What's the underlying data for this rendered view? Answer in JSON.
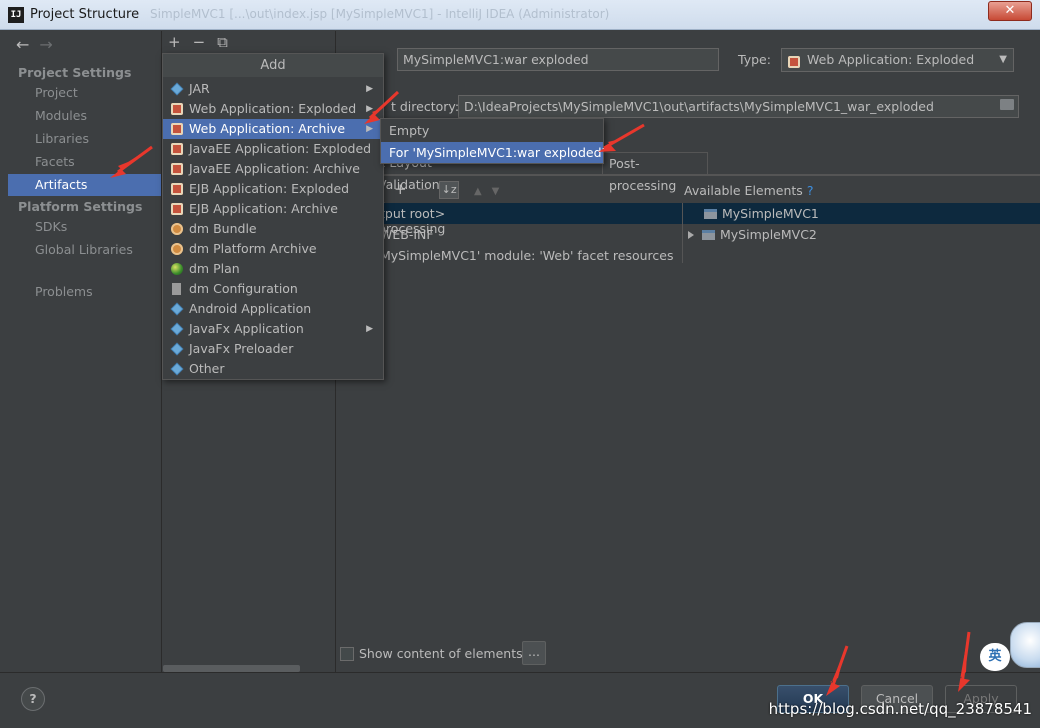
{
  "window": {
    "title": "Project Structure",
    "icon_text": "IJ",
    "ghost_title": "SimpleMVC1 [...\\out\\index.jsp [MySimpleMVC1] - IntelliJ IDEA (Administrator)",
    "close_label": "✕"
  },
  "nav": {
    "back": "←",
    "forward": "→"
  },
  "sidebar": {
    "project_settings_heading": "Project Settings",
    "project_items": [
      "Project",
      "Modules",
      "Libraries",
      "Facets",
      "Artifacts"
    ],
    "platform_settings_heading": "Platform Settings",
    "platform_items": [
      "SDKs",
      "Global Libraries"
    ],
    "problems": "Problems",
    "selected": "Artifacts"
  },
  "mid_toolbar": {
    "add": "+",
    "remove": "−",
    "copy": "⧉"
  },
  "artifact": {
    "name": "MySimpleMVC1:war exploded",
    "type_label": "Type:",
    "type_value": "Web Application: Exploded",
    "output_dir_label": "Output directory:",
    "output_dir_visible_label": "t directory:",
    "output_dir": "D:\\IdeaProjects\\MySimpleMVC1\\out\\artifacts\\MySimpleMVC1_war_exploded"
  },
  "tabs": {
    "partial_visible": "x Layout  Validation  Pre-processing",
    "post_processing": "Post-processing"
  },
  "layout_pane": {
    "tools": {
      "add": "+",
      "remove": "−",
      "sort": "↓z",
      "up": "▲",
      "down": "▼"
    },
    "available_label": "Available Elements",
    "help": "?",
    "left_rows": [
      "<output root>",
      "WEB-INF",
      "'MySimpleMVC1' module: 'Web' facet resources"
    ],
    "left_rows_visible": [
      "tput root>",
      "WEB-INF",
      "MySimpleMVC1' module: 'Web' facet resources"
    ],
    "available": [
      "MySimpleMVC1",
      "MySimpleMVC2"
    ]
  },
  "show_content": {
    "label": "Show content of elements",
    "dots": "..."
  },
  "add_menu": {
    "header": "Add",
    "items": [
      {
        "label": "JAR",
        "icon": "diamond",
        "submenu": true
      },
      {
        "label": "Web Application: Exploded",
        "icon": "gift",
        "submenu": true
      },
      {
        "label": "Web Application: Archive",
        "icon": "gift",
        "submenu": true,
        "selected": true
      },
      {
        "label": "JavaEE Application: Exploded",
        "icon": "gift"
      },
      {
        "label": "JavaEE Application: Archive",
        "icon": "gift"
      },
      {
        "label": "EJB Application: Exploded",
        "icon": "gift"
      },
      {
        "label": "EJB Application: Archive",
        "icon": "gift"
      },
      {
        "label": "dm Bundle",
        "icon": "ear"
      },
      {
        "label": "dm Platform Archive",
        "icon": "ear"
      },
      {
        "label": "dm Plan",
        "icon": "globe"
      },
      {
        "label": "dm Configuration",
        "icon": "doc"
      },
      {
        "label": "Android Application",
        "icon": "diamond"
      },
      {
        "label": "JavaFx Application",
        "icon": "diamond",
        "submenu": true
      },
      {
        "label": "JavaFx Preloader",
        "icon": "diamond"
      },
      {
        "label": "Other",
        "icon": "diamond"
      }
    ],
    "submenu_arrow": "▶"
  },
  "sub_menu": {
    "items": [
      "Empty",
      "For 'MySimpleMVC1:war exploded'"
    ],
    "selected": "For 'MySimpleMVC1:war exploded'"
  },
  "buttons": {
    "help": "?",
    "ok": "OK",
    "cancel": "Cancel",
    "apply": "Apply"
  },
  "watermark": "https://blog.csdn.net/qq_23878541",
  "ime_badge": "英",
  "colors": {
    "selection": "#4b6eaf",
    "annotation_arrow": "#e8372c",
    "background": "#3c3f41"
  }
}
